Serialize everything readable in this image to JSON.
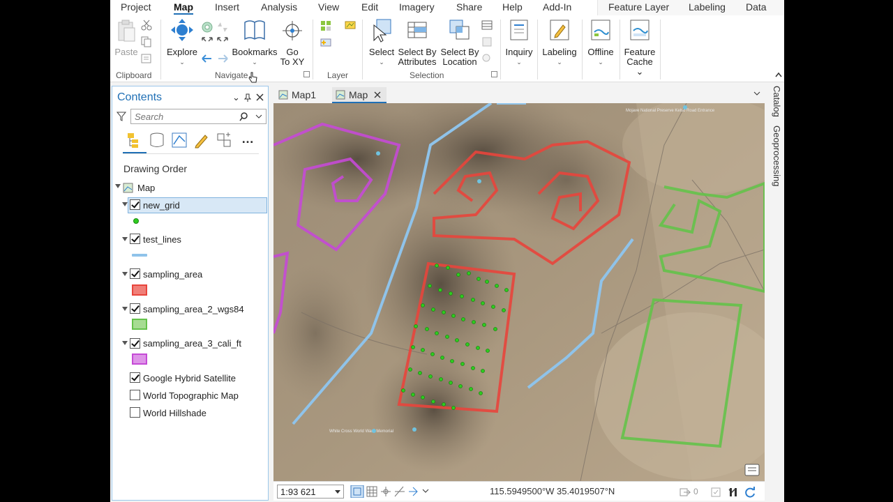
{
  "ribbon_tabs": [
    "Project",
    "Map",
    "Insert",
    "Analysis",
    "View",
    "Edit",
    "Imagery",
    "Share",
    "Help",
    "Add-In"
  ],
  "ribbon_tabs_context": [
    "Feature Layer",
    "Labeling",
    "Data"
  ],
  "ribbon": {
    "paste": "Paste",
    "explore": "Explore",
    "bookmarks": "Bookmarks",
    "goto_line1": "Go",
    "goto_line2": "To XY",
    "select": "Select",
    "select_by_attr_1": "Select By",
    "select_by_attr_2": "Attributes",
    "select_by_loc_1": "Select By",
    "select_by_loc_2": "Location",
    "inquiry": "Inquiry",
    "labeling": "Labeling",
    "offline": "Offline",
    "feature_cache_1": "Feature",
    "feature_cache_2": "Cache",
    "groups": {
      "clipboard": "Clipboard",
      "navigate": "Navigate",
      "layer": "Layer",
      "selection": "Selection"
    }
  },
  "contents": {
    "title": "Contents",
    "search_placeholder": "Search",
    "drawing_order": "Drawing Order",
    "map_name": "Map",
    "layers": [
      {
        "name": "new_grid",
        "checked": true,
        "symbol": "point",
        "color": "#2ecc1f",
        "selected": true
      },
      {
        "name": "test_lines",
        "checked": true,
        "symbol": "line",
        "color": "#8fc3ea"
      },
      {
        "name": "sampling_area",
        "checked": true,
        "symbol": "polygon",
        "color": "#e8453c"
      },
      {
        "name": "sampling_area_2_wgs84",
        "checked": true,
        "symbol": "polygon",
        "color": "#64c24a"
      },
      {
        "name": "sampling_area_3_cali_ft",
        "checked": true,
        "symbol": "polygon",
        "color": "#c54ad6"
      }
    ],
    "basemaps": [
      {
        "name": "Google Hybrid Satellite",
        "checked": true
      },
      {
        "name": "World Topographic Map",
        "checked": false
      },
      {
        "name": "World Hillshade",
        "checked": false
      }
    ]
  },
  "map_tabs": [
    "Map1",
    "Map"
  ],
  "status": {
    "scale": "1:93 621",
    "coordinates": "115.5949500°W 35.4019507°N",
    "selected_count": "0"
  },
  "dock_tabs": [
    "Catalog",
    "Geoprocessing"
  ],
  "map_labels": {
    "top_right": "Mojave National Preserve Kelso Road Entrance",
    "bottom": "White Cross World War I Memorial"
  }
}
